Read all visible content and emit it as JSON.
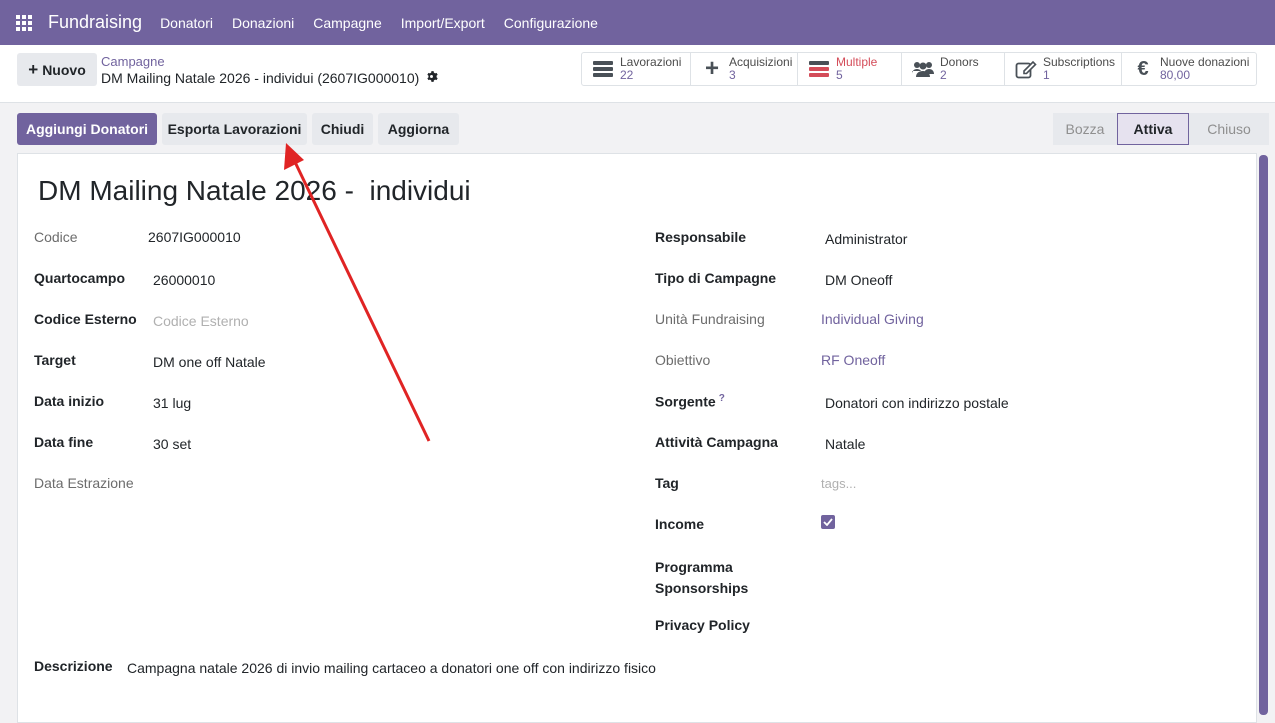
{
  "navbar": {
    "brand": "Fundraising",
    "menu": [
      "Donatori",
      "Donazioni",
      "Campagne",
      "Import/Export",
      "Configurazione"
    ]
  },
  "control_panel": {
    "new_label": "Nuovo",
    "breadcrumb": "Campagne",
    "record_title": "DM Mailing Natale 2026 - individui (2607IG000010)",
    "smart_buttons": [
      {
        "label": "Lavorazioni",
        "value": "22",
        "icon": "stack-icon"
      },
      {
        "label": "Acquisizioni",
        "value": "3",
        "icon": "plus-icon"
      },
      {
        "label": "Multiple",
        "value": "5",
        "icon": "stack-icon"
      },
      {
        "label": "Donors",
        "value": "2",
        "icon": "users-icon"
      },
      {
        "label": "Subscriptions",
        "value": "1",
        "icon": "edit-icon"
      },
      {
        "label": "Nuove donazioni",
        "value": "80,00",
        "icon": "euro-icon"
      }
    ]
  },
  "statusbar": {
    "buttons": [
      "Aggiungi Donatori",
      "Esporta Lavorazioni",
      "Chiudi",
      "Aggiorna"
    ],
    "stages": [
      "Bozza",
      "Attiva",
      "Chiuso"
    ],
    "active_stage": "Attiva"
  },
  "form": {
    "title": "DM Mailing Natale 2026 -  individui",
    "left": [
      {
        "label": "Codice",
        "value": "2607IG000010"
      },
      {
        "label": "Quartocampo",
        "value": "26000010"
      },
      {
        "label": "Codice Esterno",
        "value": "Codice Esterno"
      },
      {
        "label": "Target",
        "value": "DM one off Natale"
      },
      {
        "label": "Data inizio",
        "value": "31 lug"
      },
      {
        "label": "Data fine",
        "value": "30 set"
      },
      {
        "label": "Data Estrazione",
        "value": ""
      }
    ],
    "right": [
      {
        "label": "Responsabile",
        "value": "Administrator"
      },
      {
        "label": "Tipo di Campagne",
        "value": "DM Oneoff"
      },
      {
        "label": "Unità Fundraising",
        "value": "Individual Giving"
      },
      {
        "label": "Obiettivo",
        "value": "RF Oneoff"
      },
      {
        "label": "Sorgente",
        "value": "Donatori con indirizzo postale"
      },
      {
        "label": "Attività Campagna",
        "value": "Natale"
      },
      {
        "label": "Tag",
        "value": "tags..."
      },
      {
        "label": "Income",
        "value": ""
      },
      {
        "label": "Programma Sponsorships",
        "value": ""
      },
      {
        "label": "Privacy Policy",
        "value": ""
      }
    ],
    "help_mark": "?",
    "description_label": "Descrizione",
    "description": "Campagna natale 2026 di invio mailing cartaceo a donatori one off con indirizzo fisico"
  },
  "colors": {
    "brand": "#71639e",
    "annotation_arrow": "#e02424"
  }
}
